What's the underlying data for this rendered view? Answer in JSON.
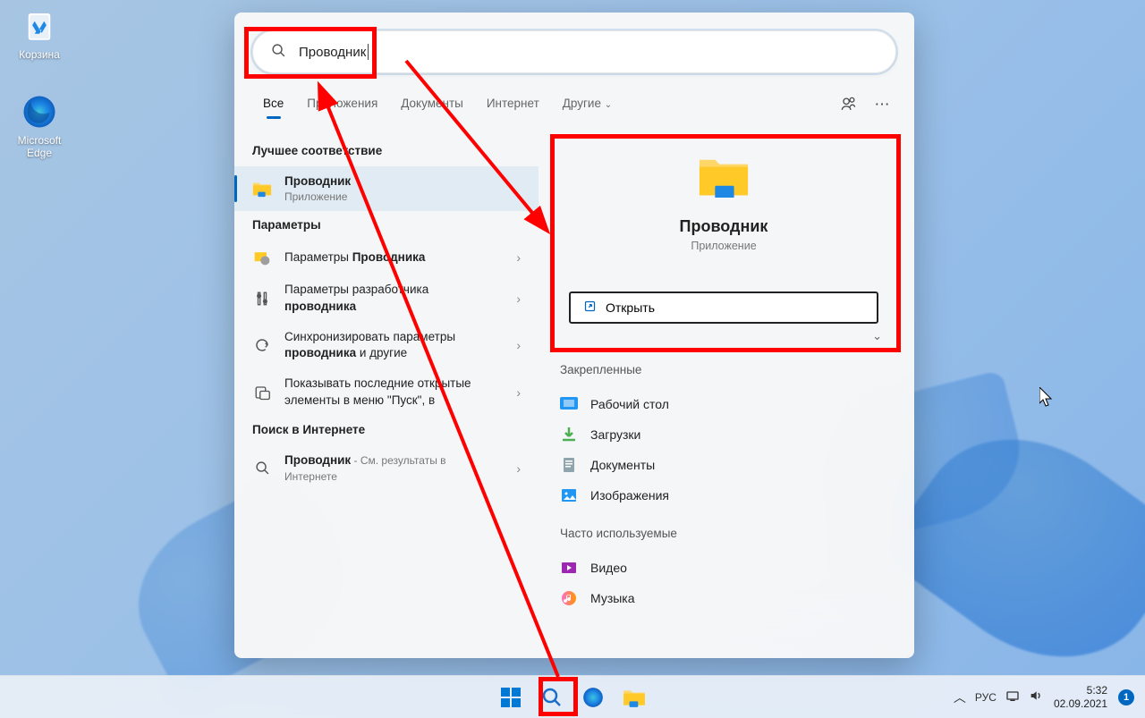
{
  "desktop": {
    "recycle": "Корзина",
    "edge": "Microsoft Edge"
  },
  "search": {
    "query": "Проводник",
    "tabs": {
      "all": "Все",
      "apps": "Приложения",
      "docs": "Документы",
      "web": "Интернет",
      "more": "Другие"
    },
    "sections": {
      "best": "Лучшее соответствие",
      "settings": "Параметры",
      "web": "Поиск в Интернете"
    },
    "best_result": {
      "title": "Проводник",
      "sub": "Приложение"
    },
    "settings_results": [
      {
        "pre": "Параметры ",
        "bold": "Проводника",
        "post": ""
      },
      {
        "pre": "Параметры разработчика ",
        "bold": "проводника",
        "post": ""
      },
      {
        "pre": "Синхронизировать параметры ",
        "bold": "проводника",
        "post": " и другие"
      },
      {
        "pre": "Показывать последние открытые элементы в меню \"Пуск\", в",
        "bold": "",
        "post": ""
      }
    ],
    "web_result": {
      "title": "Проводник",
      "sub": " - См. результаты в Интернете"
    },
    "preview": {
      "title": "Проводник",
      "sub": "Приложение",
      "open": "Открыть",
      "pinned_title": "Закрепленные",
      "pinned": [
        "Рабочий стол",
        "Загрузки",
        "Документы",
        "Изображения"
      ],
      "frequent_title": "Часто используемые",
      "frequent": [
        "Видео",
        "Музыка"
      ]
    }
  },
  "taskbar": {
    "lang": "РУС",
    "time": "5:32",
    "date": "02.09.2021"
  }
}
